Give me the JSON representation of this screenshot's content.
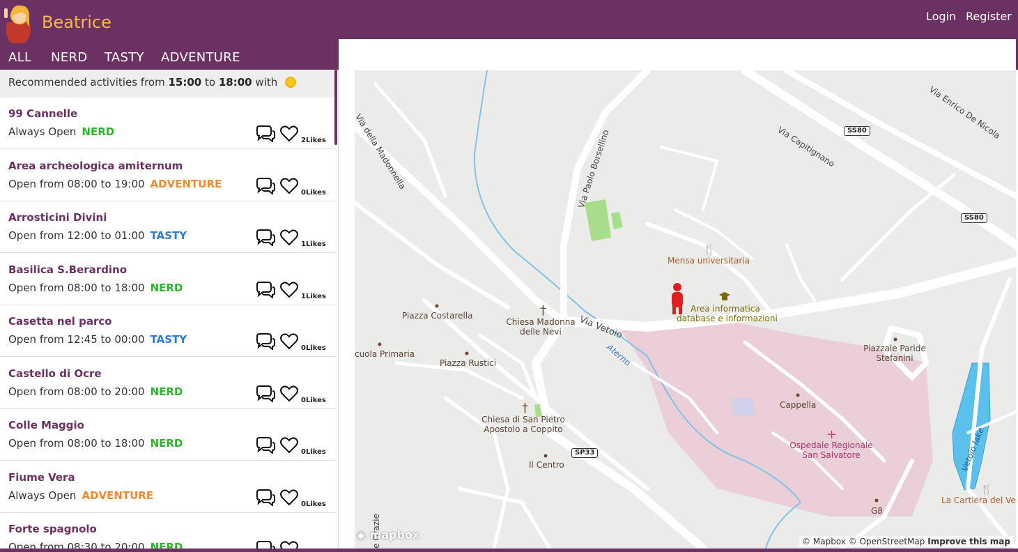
{
  "app": {
    "brand": "Beatrice",
    "login": "Login",
    "register": "Register",
    "header_color": "#6b3163",
    "brand_color": "#f7b84a"
  },
  "nav": {
    "items": [
      "ALL",
      "NERD",
      "TASTY",
      "ADVENTURE"
    ]
  },
  "recommendation": {
    "prefix": "Recommended activities from",
    "from": "15:00",
    "to_word": "to",
    "to": "18:00",
    "suffix": "with",
    "weather_icon": "sun-icon"
  },
  "activities": [
    {
      "name": "99 Cannelle",
      "hours": "Always Open",
      "category": "NERD",
      "likes": "2Likes"
    },
    {
      "name": "Area archeologica amiternum",
      "hours": "Open from 08:00 to 19:00",
      "category": "ADVENTURE",
      "likes": "0Likes"
    },
    {
      "name": "Arrosticini Divini",
      "hours": "Open from 12:00 to 01:00",
      "category": "TASTY",
      "likes": "1Likes"
    },
    {
      "name": "Basilica S.Berardino",
      "hours": "Open from 08:00 to 18:00",
      "category": "NERD",
      "likes": "1Likes"
    },
    {
      "name": "Casetta nel parco",
      "hours": "Open from 12:45 to 00:00",
      "category": "TASTY",
      "likes": "0Likes"
    },
    {
      "name": "Castello di Ocre",
      "hours": "Open from 08:00 to 20:00",
      "category": "NERD",
      "likes": "0Likes"
    },
    {
      "name": "Colle Maggio",
      "hours": "Open from 08:00 to 18:00",
      "category": "NERD",
      "likes": "0Likes"
    },
    {
      "name": "Fiume Vera",
      "hours": "Always Open",
      "category": "ADVENTURE",
      "likes": "0Likes"
    },
    {
      "name": "Forte spagnolo",
      "hours": "Open from 08:30 to 20:00",
      "category": "NERD",
      "likes": ""
    }
  ],
  "category_colors": {
    "NERD": "#2ab52a",
    "TASTY": "#2e7bd6",
    "ADVENTURE": "#f0892f"
  },
  "map": {
    "labels": {
      "via_della_madonnella": "Via della Madonnella",
      "via_paolo_borsellino": "Via Paolo Borsellino",
      "via_capitignano": "Via Capitignano",
      "via_enrico_de_nicola": "Via Enrico De Nicola",
      "ss80_a": "SS80",
      "ss80_b": "SS80",
      "mensa": "Mensa universitaria",
      "area_informatica_1": "Area informatica",
      "area_informatica_2": "database e informazioni",
      "piazza_costarella": "Piazza Costarella",
      "chiesa_madonna_1": "Chiesa Madonna",
      "chiesa_madonna_2": "delle Nevi",
      "via_vetoio": "Via Vetoio",
      "aterno": "Aterno",
      "scuola_primaria": "cuola Primaria",
      "piazza_rustici": "Piazza Rustici",
      "piazzale_paride_1": "Piazzale Paride",
      "piazzale_paride_2": "Stefanini",
      "cappella": "Cappella",
      "chiesa_san_pietro_1": "Chiesa di San Pietro",
      "chiesa_san_pietro_2": "Apostolo a Coppito",
      "sp33": "SP33",
      "ospedale_1": "Ospedale Regionale",
      "ospedale_2": "San Salvatore",
      "il_centro": "Il Centro",
      "vetoio_lake": "Vetoio lake",
      "la_cartiera": "La Cartiera del Vet",
      "g8": "G8",
      "grazie": "e Grazie",
      "mapbox": "mapbox"
    },
    "attribution": {
      "mapbox": "© Mapbox",
      "osm": "© OpenStreetMap",
      "improve": "Improve this map"
    }
  }
}
